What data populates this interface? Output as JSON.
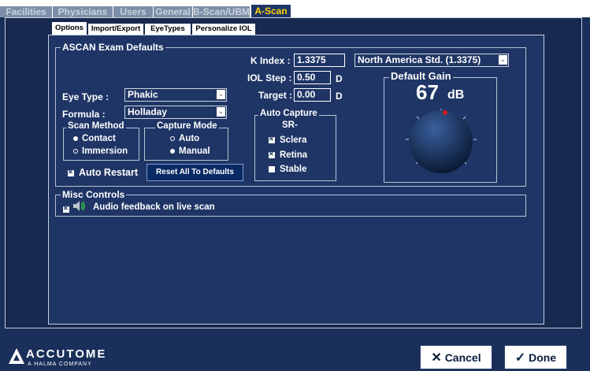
{
  "top_tabs": [
    "Facilities",
    "Physicians",
    "Users",
    "General",
    "B-Scan/UBM",
    "A-Scan"
  ],
  "sub_tabs": [
    "Options",
    "Import/Export",
    "EyeTypes",
    "Personalize IOL"
  ],
  "exam_defaults": {
    "title": "ASCAN Exam Defaults",
    "k_index_label": "K Index :",
    "k_index_value": "1.3375",
    "k_index_select": "North America Std. (1.3375)",
    "iol_step_label": "IOL Step :",
    "iol_step_value": "0.50",
    "iol_step_unit": "D",
    "target_label": "Target :",
    "target_value": "0.00",
    "target_unit": "D",
    "eye_type_label": "Eye Type :",
    "eye_type_value": "Phakic",
    "formula_label": "Formula :",
    "formula_value": "Holladay",
    "scan_method_title": "Scan Method",
    "scan_method_options": [
      "Contact",
      "Immersion"
    ],
    "capture_mode_title": "Capture Mode",
    "capture_mode_options": [
      "Auto",
      "Manual"
    ],
    "auto_restart_label": "Auto Restart",
    "reset_button": "Reset All To Defaults",
    "auto_capture_title": "Auto Capture",
    "auto_capture_sub": "SR-",
    "auto_capture_options": [
      "Sclera",
      "Retina",
      "Stable"
    ],
    "gain_title": "Default Gain",
    "gain_value": "67",
    "gain_unit": "dB"
  },
  "misc": {
    "title": "Misc Controls",
    "audio_label": "Audio feedback on live scan"
  },
  "brand": {
    "name": "ACCUTOME",
    "tagline": "A HALMA COMPANY"
  },
  "buttons": {
    "cancel": "Cancel",
    "done": "Done"
  },
  "colors": {
    "background": "#1a2f5a",
    "panel": "#1f3566",
    "active_tab_text": "#ffd200"
  }
}
